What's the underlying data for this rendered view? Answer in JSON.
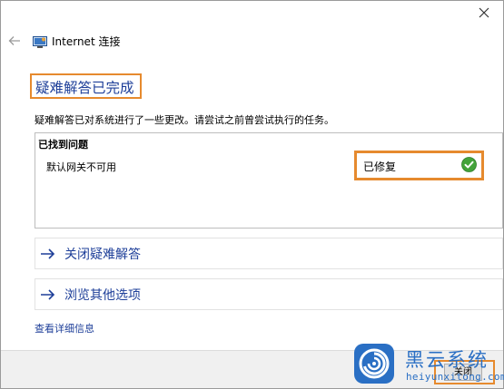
{
  "window": {
    "app_title": "Internet 连接",
    "close_icon": "close-icon",
    "back_icon": "back-arrow-icon",
    "app_icon": "network-connection-icon"
  },
  "main": {
    "heading": "疑难解答已完成",
    "description": "疑难解答已对系统进行了一些更改。请尝试之前曾尝试执行的任务。",
    "problems_header": "已找到问题",
    "problems": [
      {
        "name": "默认网关不可用",
        "status": "已修复",
        "status_icon": "green-check-icon"
      }
    ],
    "actions": [
      {
        "label": "关闭疑难解答",
        "icon": "arrow-right-icon"
      },
      {
        "label": "浏览其他选项",
        "icon": "arrow-right-icon"
      }
    ],
    "details_link": "查看详细信息"
  },
  "footer": {
    "close_button": "关闭"
  },
  "watermark": {
    "text_cn": "黑云系统",
    "text_en": "heiyunxitong.com",
    "logo_icon": "swirl-logo-icon"
  },
  "colors": {
    "link_blue": "#1e3f99",
    "highlight_orange": "#e68a2e",
    "check_green": "#43a33a",
    "watermark_blue": "#2a6fc4"
  }
}
